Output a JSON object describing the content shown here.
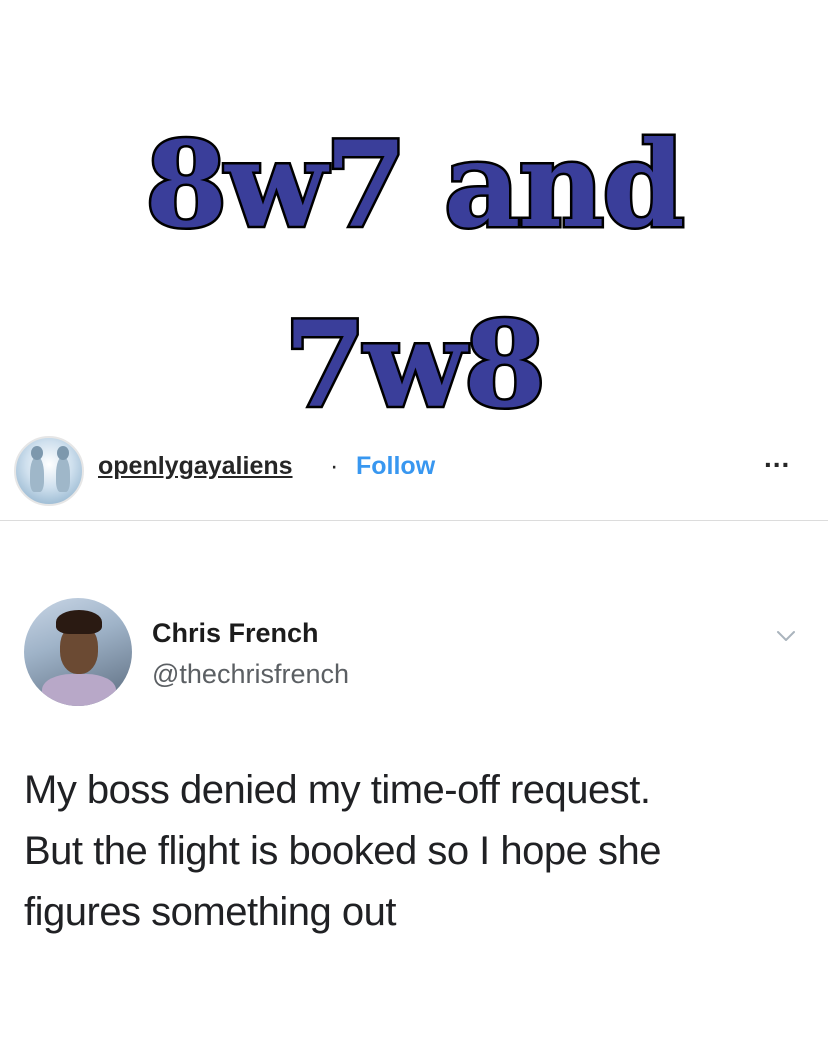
{
  "headline": {
    "line1": "8w7 and",
    "line2": "7w8",
    "color": "#3a3e9a"
  },
  "post_header": {
    "avatar_icon": "alien-profile-icon",
    "username": "openlygayaliens",
    "separator": "·",
    "follow_label": "Follow",
    "follow_color": "#3897f0",
    "more_icon": "more-options-icon",
    "more_label": "..."
  },
  "tweet": {
    "display_name": "Chris French",
    "handle": "@thechrisfrench",
    "chevron_icon": "chevron-down-icon",
    "text_lines": [
      "My boss denied my time-off request.",
      "But the flight is booked so I hope she",
      "figures something out"
    ]
  }
}
